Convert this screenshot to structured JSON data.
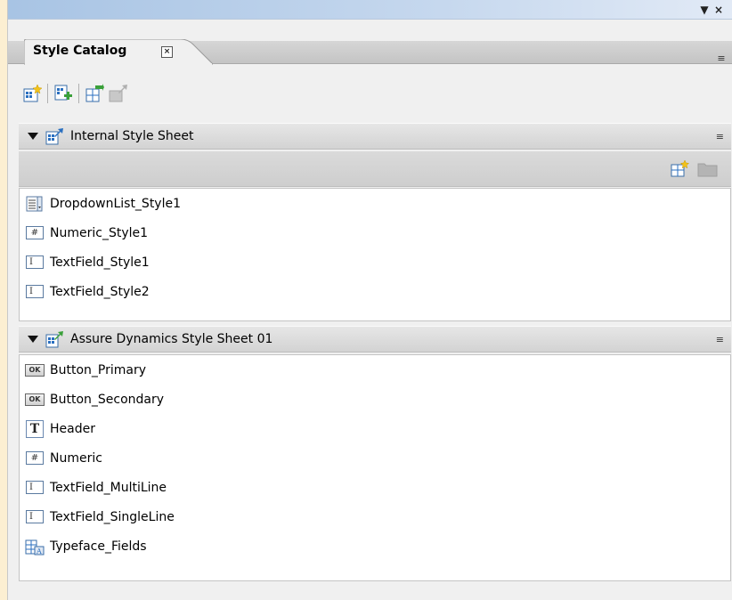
{
  "window": {
    "dropdown_glyph": "▼",
    "close_glyph": "×"
  },
  "tab": {
    "label": "Style Catalog",
    "close_glyph": "×"
  },
  "panel_menu_glyph": "≡",
  "toolbar": {
    "buttons": [
      {
        "icon": "new-style-sheet-icon",
        "enabled": true
      },
      {
        "icon": "add-style-sheet-icon",
        "enabled": true
      },
      {
        "icon": "import-style-icon",
        "enabled": true
      },
      {
        "icon": "export-style-icon",
        "enabled": false
      }
    ]
  },
  "sections": [
    {
      "title": "Internal Style Sheet",
      "icon": "internal-style-sheet-icon",
      "expanded": true,
      "sub_toolbar": [
        {
          "icon": "new-style-icon",
          "enabled": true
        },
        {
          "icon": "folder-icon",
          "enabled": false
        }
      ],
      "items": [
        {
          "label": "DropdownList_Style1",
          "icon": "dropdown-list-icon"
        },
        {
          "label": "Numeric_Style1",
          "icon": "numeric-field-icon",
          "glyph": "#"
        },
        {
          "label": "TextField_Style1",
          "icon": "text-field-icon",
          "glyph": "I"
        },
        {
          "label": "TextField_Style2",
          "icon": "text-field-icon",
          "glyph": "I"
        }
      ]
    },
    {
      "title": "Assure Dynamics Style Sheet 01",
      "icon": "external-style-sheet-icon",
      "expanded": true,
      "items": [
        {
          "label": "Button_Primary",
          "icon": "button-icon",
          "glyph": "OK"
        },
        {
          "label": "Button_Secondary",
          "icon": "button-icon",
          "glyph": "OK"
        },
        {
          "label": "Header",
          "icon": "header-text-icon",
          "glyph": "T"
        },
        {
          "label": "Numeric",
          "icon": "numeric-field-icon",
          "glyph": "#"
        },
        {
          "label": "TextField_MultiLine",
          "icon": "text-field-icon",
          "glyph": "I"
        },
        {
          "label": "TextField_SingleLine",
          "icon": "text-field-icon",
          "glyph": "I"
        },
        {
          "label": "Typeface_Fields",
          "icon": "typeface-fields-icon"
        }
      ]
    }
  ],
  "colors": {
    "outer_background": "#fcefd2",
    "panel_background": "#f0f0f0",
    "title_bar_start": "#a8c4e4",
    "list_background": "#ffffff",
    "icon_blue": "#2a6fc0",
    "icon_green": "#3aa03a",
    "icon_yellow": "#f2c21a"
  }
}
